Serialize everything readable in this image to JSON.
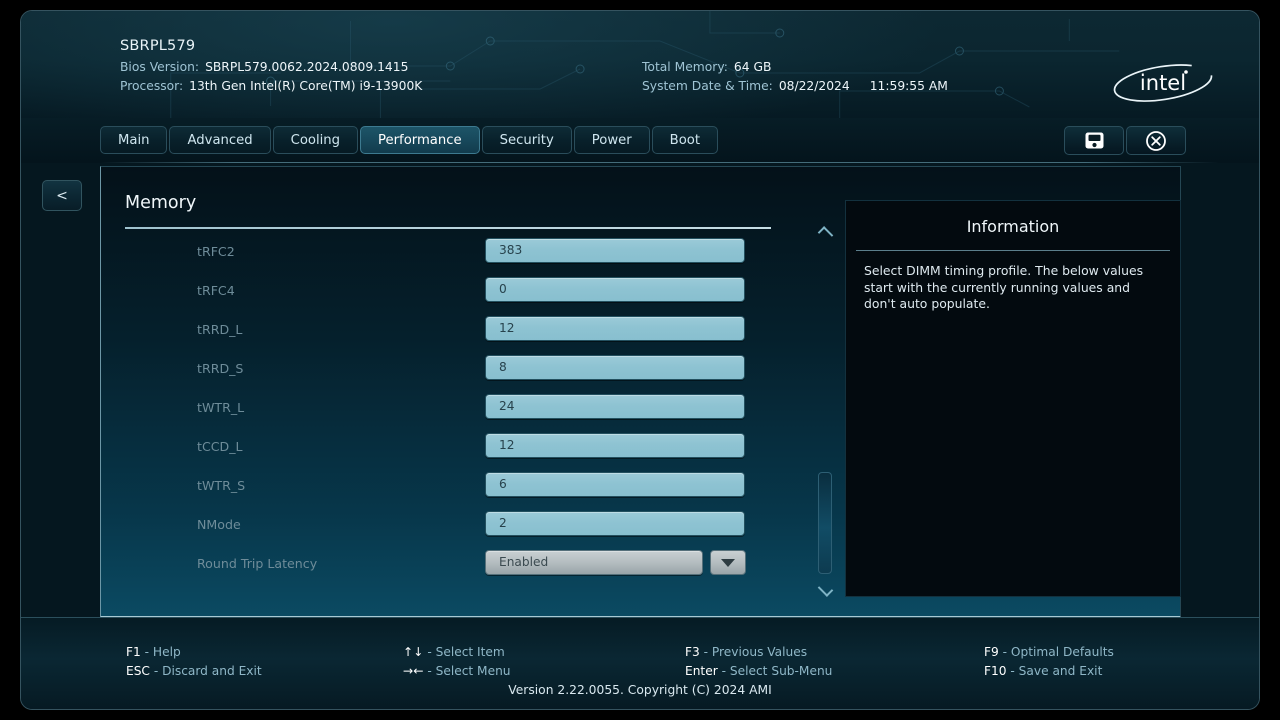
{
  "header": {
    "board_name": "SBRPL579",
    "bios_version_label": "Bios Version:",
    "bios_version_value": "SBRPL579.0062.2024.0809.1415",
    "processor_label": "Processor:",
    "processor_value": "13th Gen Intel(R) Core(TM) i9-13900K",
    "total_memory_label": "Total Memory:",
    "total_memory_value": "64 GB",
    "datetime_label": "System Date & Time:",
    "date_value": "08/22/2024",
    "time_value": "11:59:55 AM",
    "brand_logo": "intel-logo"
  },
  "tabs": [
    {
      "label": "Main",
      "active": false
    },
    {
      "label": "Advanced",
      "active": false
    },
    {
      "label": "Cooling",
      "active": false
    },
    {
      "label": "Performance",
      "active": true
    },
    {
      "label": "Security",
      "active": false
    },
    {
      "label": "Power",
      "active": false
    },
    {
      "label": "Boot",
      "active": false
    }
  ],
  "header_buttons": [
    {
      "icon": "save-icon",
      "name": "save-button"
    },
    {
      "icon": "exit-circle-x-icon",
      "name": "exit-button"
    }
  ],
  "back_button": {
    "label": "<"
  },
  "section": {
    "title": "Memory"
  },
  "rows": [
    {
      "label": "tRFC2",
      "value": "383",
      "type": "text"
    },
    {
      "label": "tRFC4",
      "value": "0",
      "type": "text"
    },
    {
      "label": "tRRD_L",
      "value": "12",
      "type": "text"
    },
    {
      "label": "tRRD_S",
      "value": "8",
      "type": "text"
    },
    {
      "label": "tWTR_L",
      "value": "24",
      "type": "text"
    },
    {
      "label": "tCCD_L",
      "value": "12",
      "type": "text"
    },
    {
      "label": "tWTR_S",
      "value": "6",
      "type": "text"
    },
    {
      "label": "NMode",
      "value": "2",
      "type": "text"
    },
    {
      "label": "Round Trip Latency",
      "value": "Enabled",
      "type": "dropdown"
    }
  ],
  "scrollbar": {
    "up_icon": "chevron-up-icon",
    "down_icon": "chevron-down-icon"
  },
  "info": {
    "title": "Information",
    "body": "Select DIMM timing profile. The below values start with the currently running values and don't auto populate."
  },
  "footer": {
    "hints": [
      {
        "key": "F1",
        "desc": "- Help"
      },
      {
        "key": "ESC",
        "desc": "- Discard and Exit"
      },
      {
        "key": "↑↓",
        "desc": "- Select Item"
      },
      {
        "key": "→←",
        "desc": "- Select Menu"
      },
      {
        "key": "F3",
        "desc": "- Previous Values"
      },
      {
        "key": "Enter",
        "desc": "- Select Sub-Menu"
      },
      {
        "key": "F9",
        "desc": "- Optimal Defaults"
      },
      {
        "key": "F10",
        "desc": "- Save and Exit"
      }
    ],
    "version": "Version 2.22.0055. Copyright (C) 2024 AMI"
  },
  "colors": {
    "accent": "#1d5568",
    "field_fill": "#8ec3d2",
    "panel_bottom": "#0b4a62",
    "label_text": "#6e8c99"
  }
}
